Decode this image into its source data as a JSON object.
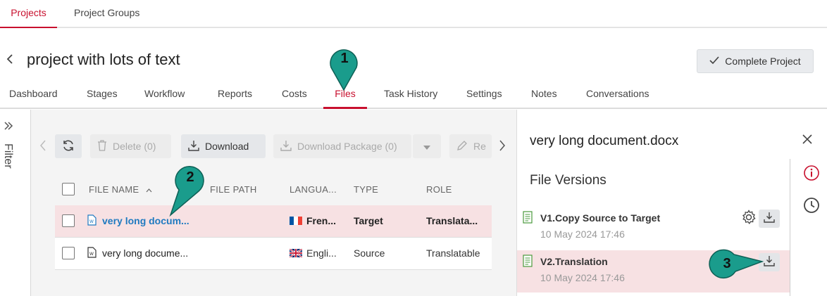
{
  "top_tabs": [
    "Projects",
    "Project Groups"
  ],
  "project": {
    "title": "project with lots of text",
    "complete_label": "Complete Project"
  },
  "nav_tabs": [
    "Dashboard",
    "Stages",
    "Workflow",
    "Reports",
    "Costs",
    "Files",
    "Task History",
    "Settings",
    "Notes",
    "Conversations"
  ],
  "filter_label": "Filter",
  "toolbar": {
    "delete_label": "Delete (0)",
    "download_label": "Download",
    "download_package_label": "Download Package (0)",
    "rename_label": "Re"
  },
  "table": {
    "headers": [
      "FILE NAME",
      "FILE PATH",
      "LANGUA...",
      "TYPE",
      "ROLE"
    ],
    "rows": [
      {
        "name": "very long docum...",
        "path": "",
        "language": "Fren...",
        "type": "Target",
        "role": "Translata..."
      },
      {
        "name": "very long docume...",
        "path": "",
        "language": "Engli...",
        "type": "Source",
        "role": "Translatable"
      }
    ]
  },
  "details": {
    "title": "very long document.docx",
    "versions_title": "File Versions",
    "versions": [
      {
        "name": "V1.Copy Source to Target",
        "date": "10 May 2024 17:46"
      },
      {
        "name": "V2.Translation",
        "date": "10 May 2024 17:46"
      }
    ]
  },
  "callouts": [
    "1",
    "2",
    "3"
  ],
  "colors": {
    "accent": "#c8102e",
    "link": "#1f7ac0",
    "callout": "#1a9c8c",
    "selected_row": "#f7e1e3"
  },
  "icons": [
    "chevron-left-icon",
    "check-icon",
    "double-chevron-right-icon",
    "refresh-icon",
    "trash-icon",
    "download-icon",
    "pencil-icon",
    "chevron-right-icon",
    "word-doc-icon",
    "close-icon",
    "info-icon",
    "clock-icon",
    "gear-icon",
    "version-doc-icon",
    "french-flag-icon",
    "uk-flag-icon",
    "caret-down-icon",
    "sort-asc-icon"
  ]
}
